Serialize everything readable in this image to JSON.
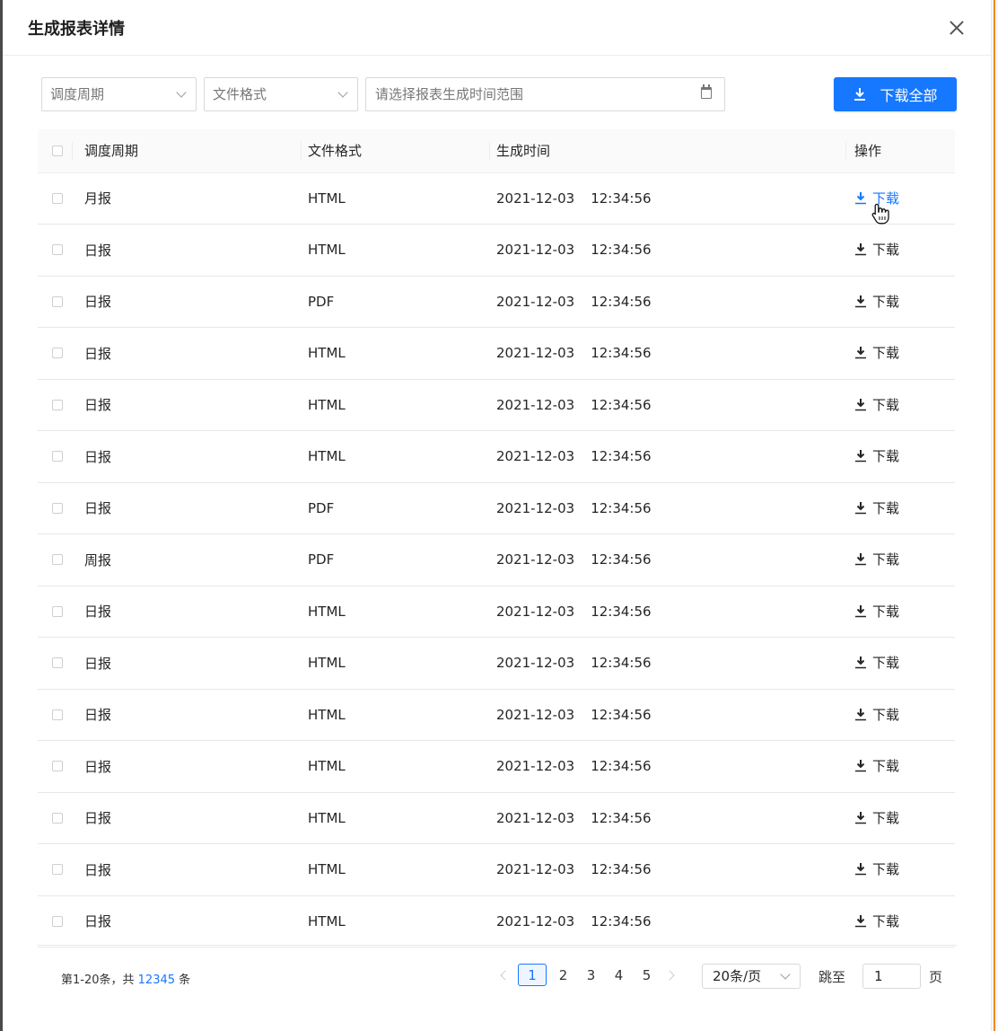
{
  "modal": {
    "title": "生成报表详情"
  },
  "filters": {
    "schedule_placeholder": "调度周期",
    "format_placeholder": "文件格式",
    "range_placeholder": "请选择报表生成时间范围",
    "download_all": "下载全部"
  },
  "table": {
    "columns": [
      "调度周期",
      "文件格式",
      "生成时间",
      "操作"
    ],
    "rows": [
      {
        "period": "月报",
        "format": "HTML",
        "date": "2021-12-03",
        "time": "12:34:56",
        "action": "下载",
        "action_state": "hover"
      },
      {
        "period": "日报",
        "format": "HTML",
        "date": "2021-12-03",
        "time": "12:34:56",
        "action": "下载"
      },
      {
        "period": "日报",
        "format": "PDF",
        "date": "2021-12-03",
        "time": "12:34:56",
        "action": "下载"
      },
      {
        "period": "日报",
        "format": "HTML",
        "date": "2021-12-03",
        "time": "12:34:56",
        "action": "下载"
      },
      {
        "period": "日报",
        "format": "HTML",
        "date": "2021-12-03",
        "time": "12:34:56",
        "action": "下载"
      },
      {
        "period": "日报",
        "format": "HTML",
        "date": "2021-12-03",
        "time": "12:34:56",
        "action": "下载"
      },
      {
        "period": "日报",
        "format": "PDF",
        "date": "2021-12-03",
        "time": "12:34:56",
        "action": "下载"
      },
      {
        "period": "周报",
        "format": "PDF",
        "date": "2021-12-03",
        "time": "12:34:56",
        "action": "下载"
      },
      {
        "period": "日报",
        "format": "HTML",
        "date": "2021-12-03",
        "time": "12:34:56",
        "action": "下载"
      },
      {
        "period": "日报",
        "format": "HTML",
        "date": "2021-12-03",
        "time": "12:34:56",
        "action": "下载"
      },
      {
        "period": "日报",
        "format": "HTML",
        "date": "2021-12-03",
        "time": "12:34:56",
        "action": "下载"
      },
      {
        "period": "日报",
        "format": "HTML",
        "date": "2021-12-03",
        "time": "12:34:56",
        "action": "下载"
      },
      {
        "period": "日报",
        "format": "HTML",
        "date": "2021-12-03",
        "time": "12:34:56",
        "action": "下载"
      },
      {
        "period": "日报",
        "format": "HTML",
        "date": "2021-12-03",
        "time": "12:34:56",
        "action": "下载"
      },
      {
        "period": "日报",
        "format": "HTML",
        "date": "2021-12-03",
        "time": "12:34:56",
        "action": "下载"
      }
    ]
  },
  "pagination": {
    "summary_prefix": "第1-20条，共",
    "total": "12345",
    "summary_suffix": "条",
    "pages": [
      "1",
      "2",
      "3",
      "4",
      "5"
    ],
    "current_page": "1",
    "page_size": "20条/页",
    "jump_label": "跳至",
    "jump_value": "1",
    "page_label": "页"
  },
  "colors": {
    "primary": "#1677ff",
    "header_bg": "#fafafa",
    "border": "#e8e8e8",
    "accent_edge": "#f08a24"
  },
  "icons": [
    "close-icon",
    "chevron-down-icon",
    "calendar-icon",
    "download-icon",
    "hand-cursor-icon",
    "chevron-left-icon",
    "chevron-right-icon"
  ]
}
